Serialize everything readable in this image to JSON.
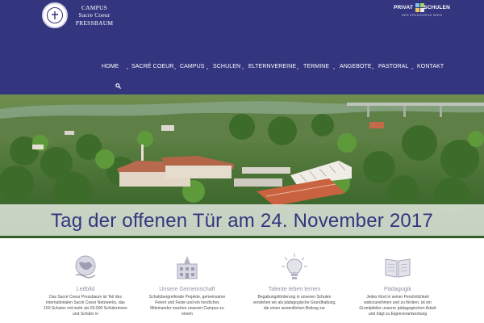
{
  "header": {
    "logo": {
      "seal_icon": "school-seal-icon",
      "line1": "CAMPUS",
      "line2": "Sacre Coeur",
      "line3": "PRESSBAUM"
    },
    "partner_logo": {
      "word1": "PRIVAT",
      "word2": "SCHULEN",
      "sub": "DER ERZDIÖZESE WIEN"
    },
    "nav": [
      {
        "label": "HOME",
        "active": true
      },
      {
        "label": "SACRÉ COEUR"
      },
      {
        "label": "CAMPUS"
      },
      {
        "label": "SCHULEN"
      },
      {
        "label": "ELTERNVEREINE"
      },
      {
        "label": "TERMINE"
      },
      {
        "label": "ANGEBOTE"
      },
      {
        "label": "PASTORAL"
      },
      {
        "label": "KONTAKT"
      }
    ],
    "search_icon": "search-icon"
  },
  "hero": {
    "title": "Tag der offenen Tür am 24. November 2017"
  },
  "features": [
    {
      "icon": "globe-hand-icon",
      "title": "Leitbild",
      "text": "Das Sacré Coeur Pressbaum ist Teil des internationalen Sacré Coeur Netzwerks, das 150 Schulen mit mehr als 60.000 Schülerinnen und Schüler in"
    },
    {
      "icon": "building-icon",
      "title": "Unsere Gemeinschaft",
      "text": "Schulübergreifende Projekte, gemeinsame Feiern und Feste und ein herzliches Miteinander machen unseren Campus zu einem"
    },
    {
      "icon": "lightbulb-icon",
      "title": "Talente leben lernen",
      "text": "Begabungsförderung in unseren Schulen verstehen wir als pädagogische Grundhaltung, die einen wesentlichen Beitrag zur"
    },
    {
      "icon": "open-book-icon",
      "title": "Pädagogik",
      "text": "Jedes Kind in seiner Persönlichkeit wahrzunehmen und zu fördern, ist ein Grundpfeiler unserer pädagogischen Arbeit und trägt zu Eigenverantwortung"
    }
  ],
  "colors": {
    "brand": "#34357f",
    "feature_title": "#8f8fa6",
    "hero_title": "#34357f"
  }
}
